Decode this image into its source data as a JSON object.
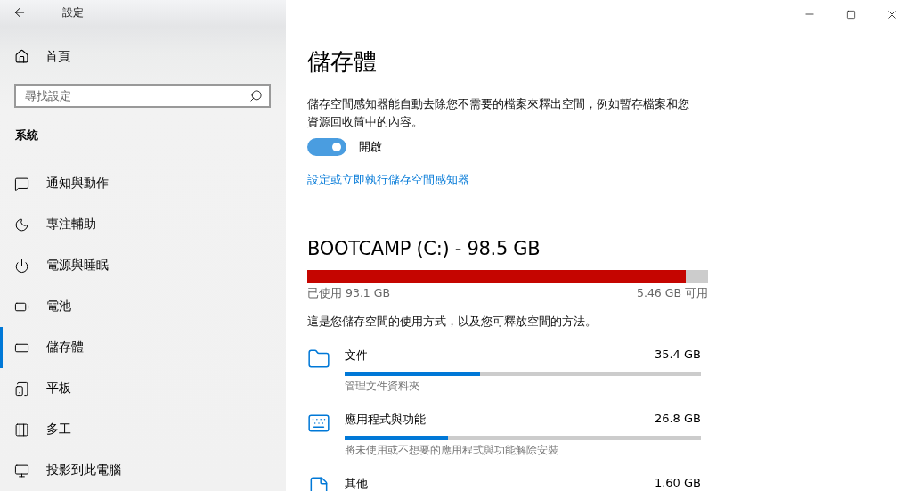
{
  "window": {
    "title": "設定"
  },
  "sidebar": {
    "home": "首頁",
    "search": {
      "placeholder": "尋找設定"
    },
    "section": "系統",
    "items": [
      {
        "label": "通知與動作",
        "selected": false
      },
      {
        "label": "專注輔助",
        "selected": false
      },
      {
        "label": "電源與睡眠",
        "selected": false
      },
      {
        "label": "電池",
        "selected": false
      },
      {
        "label": "儲存體",
        "selected": true
      },
      {
        "label": "平板",
        "selected": false
      },
      {
        "label": "多工",
        "selected": false
      },
      {
        "label": "投影到此電腦",
        "selected": false
      }
    ]
  },
  "page": {
    "title": "儲存體",
    "description": "儲存空間感知器能自動去除您不需要的檔案來釋出空間，例如暫存檔案和您資源回收筒中的內容。",
    "toggle": {
      "on": true,
      "label": "開啟"
    },
    "link": "設定或立即執行儲存空間感知器",
    "drive": {
      "title": "BOOTCAMP (C:) - 98.5 GB",
      "level": 0.945,
      "used": "已使用 93.1 GB",
      "free": "5.46 GB 可用"
    },
    "usage_intro": "這是您儲存空間的使用方式，以及您可釋放空間的方法。",
    "categories": [
      {
        "name": "文件",
        "size": "35.4 GB",
        "level": 0.38,
        "hint": "管理文件資料夾"
      },
      {
        "name": "應用程式與功能",
        "size": "26.8 GB",
        "level": 0.29,
        "hint": "將未使用或不想要的應用程式與功能解除安裝"
      },
      {
        "name": "其他",
        "size": "1.60 GB"
      }
    ]
  }
}
